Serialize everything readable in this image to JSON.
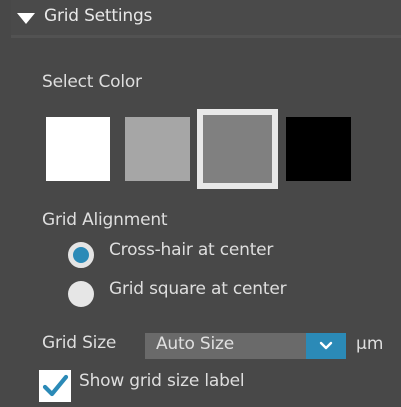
{
  "header": {
    "title": "Grid Settings",
    "collapse_icon": "triangle-down-icon"
  },
  "color_section": {
    "label": "Select Color",
    "swatches": [
      {
        "color": "#ffffff",
        "selected": false
      },
      {
        "color": "#a6a6a6",
        "selected": false
      },
      {
        "color": "#808080",
        "selected": true
      },
      {
        "color": "#000000",
        "selected": false
      }
    ]
  },
  "alignment_section": {
    "label": "Grid Alignment",
    "options": [
      {
        "label": "Cross-hair at center",
        "checked": true
      },
      {
        "label": "Grid square at center",
        "checked": false
      }
    ]
  },
  "grid_size": {
    "label": "Grid Size",
    "value": "Auto Size",
    "unit": "µm",
    "dropdown_icon": "chevron-down-icon"
  },
  "show_label": {
    "label": "Show grid size label",
    "checked": true,
    "check_icon": "checkmark-icon"
  },
  "colors": {
    "accent": "#2b8ab7",
    "panel_bg": "#484848"
  }
}
